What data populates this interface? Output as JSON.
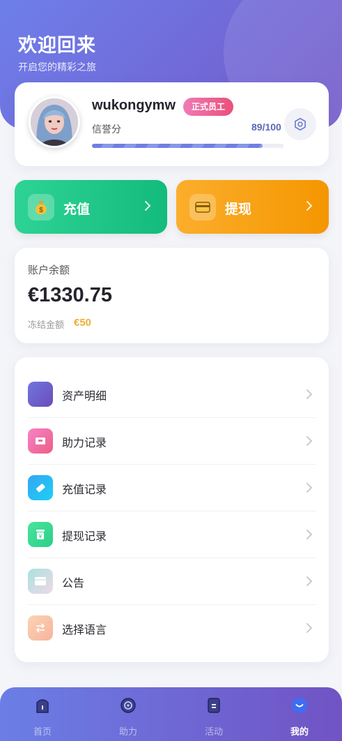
{
  "header": {
    "title": "欢迎回来",
    "subtitle": "开启您的精彩之旅"
  },
  "profile": {
    "username": "wukongymw",
    "badge": "正式员工",
    "credit_label": "信誉分",
    "credit_value": "89/100",
    "credit_progress": 0.89
  },
  "actions": {
    "recharge": "充值",
    "withdraw": "提现"
  },
  "balance": {
    "label": "账户余额",
    "amount": "€1330.75",
    "frozen_label": "冻结金额",
    "frozen_value": "€50"
  },
  "menu": [
    {
      "label": "资产明细",
      "icon": "wallet-icon",
      "color": "#6a5ac8"
    },
    {
      "label": "助力记录",
      "icon": "gift-icon",
      "color": "#ef6aa0"
    },
    {
      "label": "充值记录",
      "icon": "ticket-icon",
      "color": "#2fb7f0"
    },
    {
      "label": "提现记录",
      "icon": "yuan-box-icon",
      "color": "#3bd88a"
    },
    {
      "label": "公告",
      "icon": "card-icon",
      "color": "#9fd9dc"
    },
    {
      "label": "选择语言",
      "icon": "swap-icon",
      "color": "#f7b69a"
    }
  ],
  "tabbar": [
    {
      "label": "首页",
      "icon": "home-icon",
      "active": false
    },
    {
      "label": "助力",
      "icon": "target-icon",
      "active": false
    },
    {
      "label": "活动",
      "icon": "document-icon",
      "active": false
    },
    {
      "label": "我的",
      "icon": "profile-icon",
      "active": true
    }
  ],
  "colors": {
    "brand": "#6e7fea",
    "brand_dark": "#7358c9",
    "recharge": "#1ec486",
    "withdraw": "#f7a011"
  }
}
